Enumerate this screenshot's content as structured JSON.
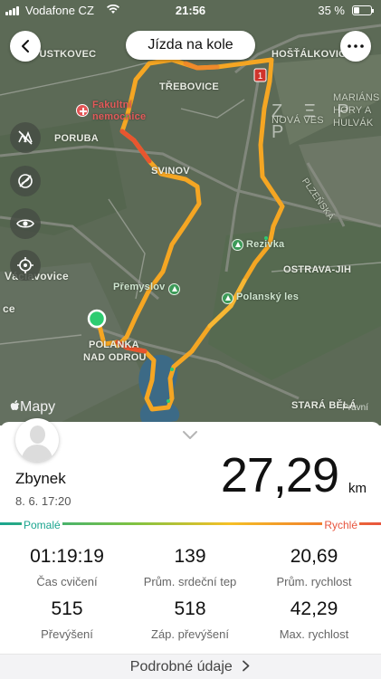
{
  "status": {
    "carrier": "Vodafone CZ",
    "time": "21:56",
    "battery": "35 %"
  },
  "header": {
    "title": "Jízda na kole"
  },
  "map": {
    "watermark": "Z Ξ P P",
    "attribution": "Mapy",
    "legal": "Právní",
    "road_badge": "1",
    "labels": {
      "pustkovec": "PUSTKOVEC",
      "hostalkovice": "HOŠŤÁLKOVICE",
      "fakultni": "Fakultní",
      "nemocnice": "nemocnice",
      "trebovice": "TŘEBOVICE",
      "poruba": "PORUBA",
      "marianske": "MARIÁNS",
      "hory": "HORY A",
      "hulvaky": "HULVÁK",
      "nova_ves": "NOVÁ VES",
      "svinov": "SVINOV",
      "plzenska": "PLZEŇSKÁ",
      "rezivka": "Rezivka",
      "vaclavovice": "Václavovice",
      "ostrava_jih": "OSTRAVA-JIH",
      "premyslov": "Přemyslov",
      "polansky": "Polanský les",
      "ce": "ce",
      "polanka": "POLANKA",
      "nad_odrou": "NAD ODROU",
      "stara_bela": "STARÁ BĚLÁ"
    }
  },
  "user": {
    "name": "Zbynek",
    "date": "8. 6. 17:20"
  },
  "summary": {
    "distance": "27,29",
    "unit": "km"
  },
  "speed_scale": {
    "slow": "Pomalé",
    "fast": "Rychlé"
  },
  "stats": [
    {
      "value": "01:19:19",
      "label": "Čas cvičení"
    },
    {
      "value": "139",
      "label": "Prům. srdeční tep"
    },
    {
      "value": "20,69",
      "label": "Prům. rychlost"
    },
    {
      "value": "515",
      "label": "Převýšení"
    },
    {
      "value": "518",
      "label": "Záp. převýšení"
    },
    {
      "value": "42,29",
      "label": "Max. rychlost"
    }
  ],
  "detail_link": "Podrobné údaje",
  "colors": {
    "route_main": "#f5a623",
    "route_fast": "#e8552f",
    "slow": "#1aa58f",
    "fast": "#e8553e",
    "start": "#2ecc71"
  }
}
